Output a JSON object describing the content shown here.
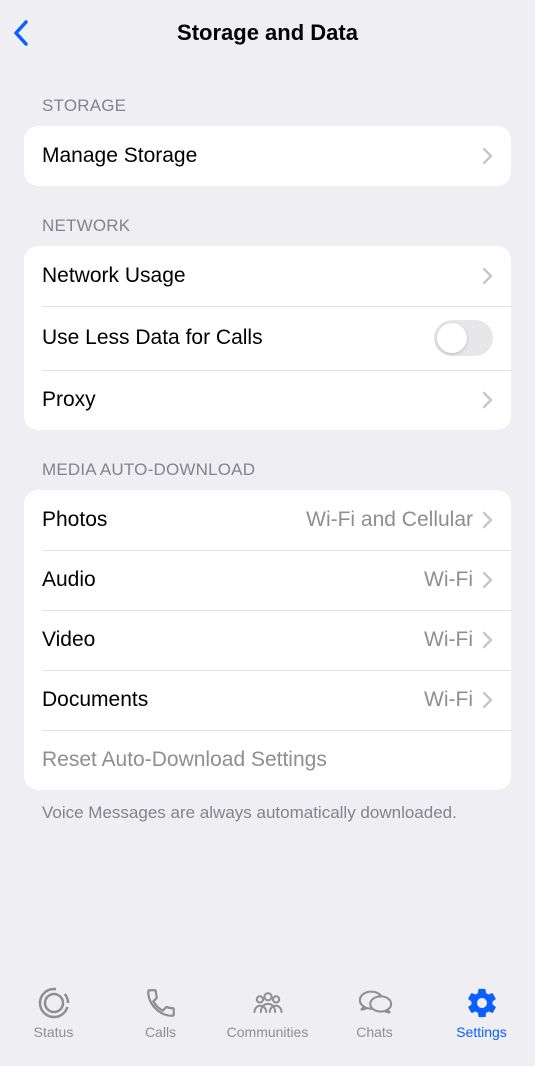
{
  "header": {
    "title": "Storage and Data"
  },
  "sections": {
    "storage": {
      "header": "STORAGE",
      "manage": "Manage Storage"
    },
    "network": {
      "header": "NETWORK",
      "usage": "Network Usage",
      "useLessData": "Use Less Data for Calls",
      "proxy": "Proxy"
    },
    "media": {
      "header": "MEDIA AUTO-DOWNLOAD",
      "photos": {
        "label": "Photos",
        "value": "Wi-Fi and Cellular"
      },
      "audio": {
        "label": "Audio",
        "value": "Wi-Fi"
      },
      "video": {
        "label": "Video",
        "value": "Wi-Fi"
      },
      "documents": {
        "label": "Documents",
        "value": "Wi-Fi"
      },
      "reset": "Reset Auto-Download Settings",
      "footer": "Voice Messages are always automatically downloaded."
    }
  },
  "tabs": {
    "status": "Status",
    "calls": "Calls",
    "communities": "Communities",
    "chats": "Chats",
    "settings": "Settings"
  }
}
